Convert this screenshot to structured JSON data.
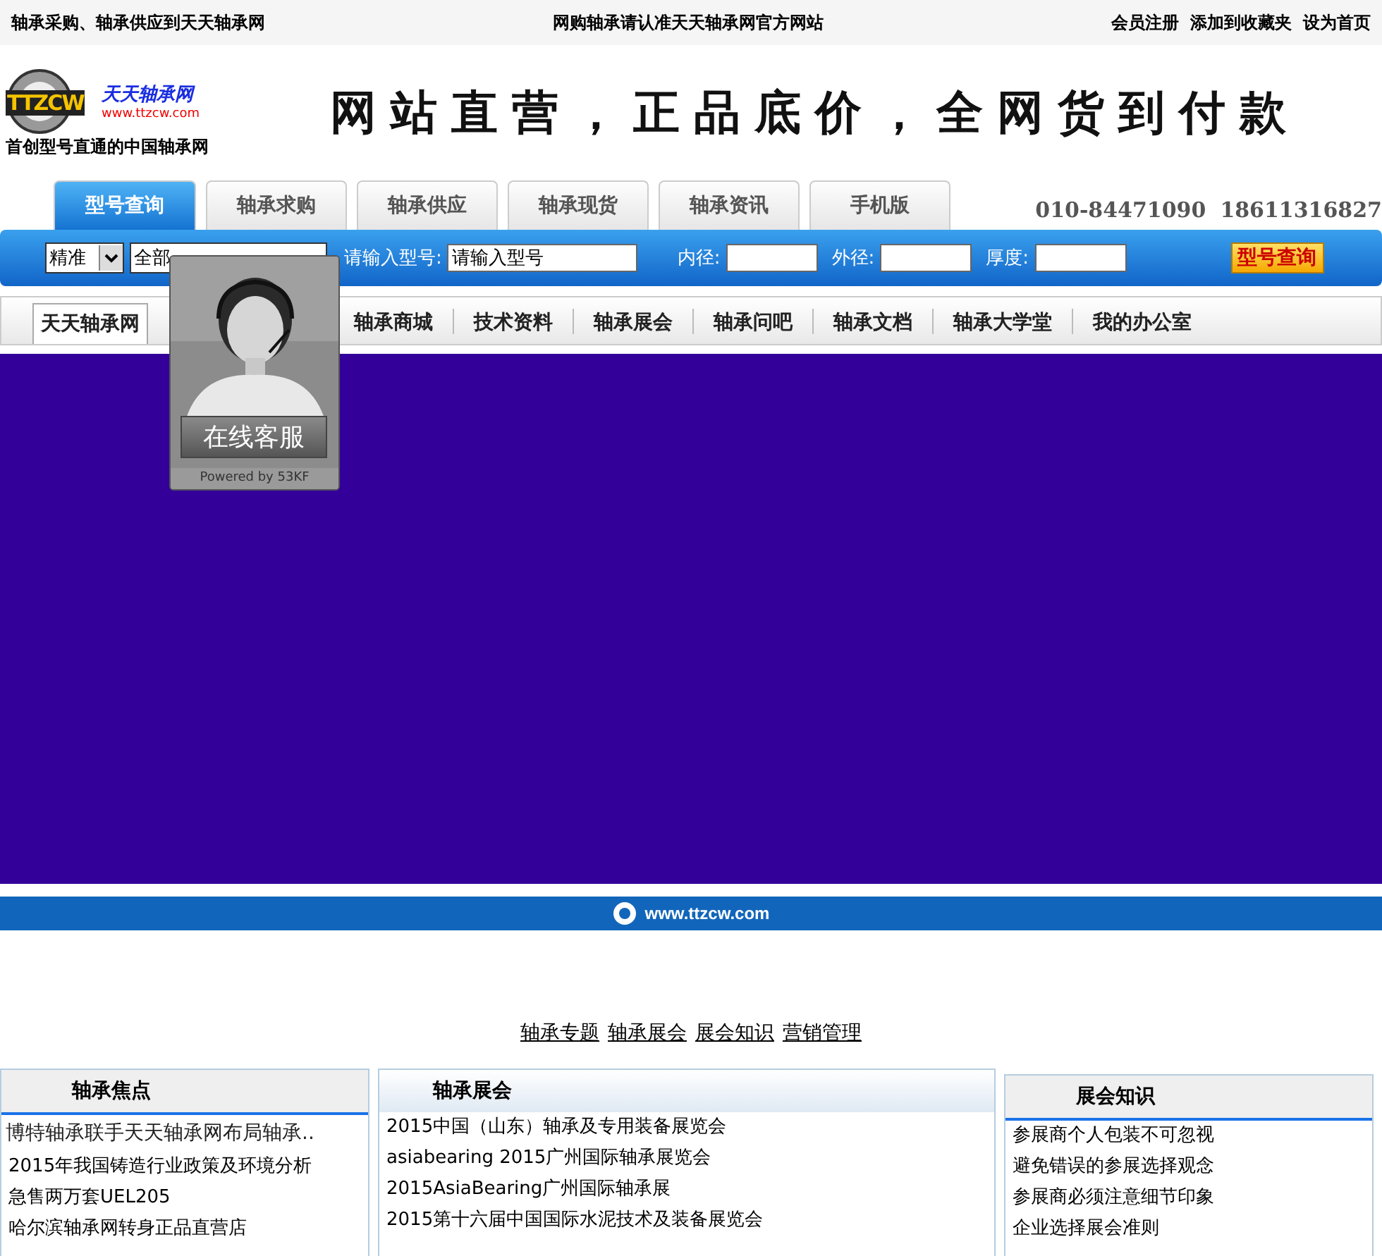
{
  "top_bar": {
    "left": "轴承采购、轴承供应到天天轴承网",
    "center": "网购轴承请认准天天轴承网官方网站",
    "links": [
      "会员注册",
      "添加到收藏夹",
      "设为首页"
    ]
  },
  "header": {
    "logo_text": "TTZCW",
    "logo_name": "天天轴承网",
    "logo_url": "www.ttzcw.com",
    "tagline": "首创型号直通的中国轴承网",
    "slogan": "网站直营，正品底价，全网货到付款"
  },
  "tabs": [
    {
      "label": "型号查询",
      "selected": true
    },
    {
      "label": "轴承求购",
      "selected": false
    },
    {
      "label": "轴承供应",
      "selected": false
    },
    {
      "label": "轴承现货",
      "selected": false
    },
    {
      "label": "轴承资讯",
      "selected": false
    },
    {
      "label": "手机版",
      "selected": false
    }
  ],
  "phones": [
    "010-84471090",
    "18611316827"
  ],
  "search": {
    "mode": "精准",
    "scope": "全部",
    "model_label": "请输入型号:",
    "model_value": "请输入型号",
    "inner_label": "内径:",
    "outer_label": "外径:",
    "thickness_label": "厚度:",
    "button": "型号查询"
  },
  "nav": [
    {
      "label": "天天轴承网",
      "selected": true
    },
    {
      "label": "轴承商城",
      "selected": false
    },
    {
      "label": "技术资料",
      "selected": false
    },
    {
      "label": "轴承展会",
      "selected": false
    },
    {
      "label": "轴承问吧",
      "selected": false
    },
    {
      "label": "轴承文档",
      "selected": false
    },
    {
      "label": "轴承大学堂",
      "selected": false
    },
    {
      "label": "我的办公室",
      "selected": false
    }
  ],
  "chat_widget": {
    "button": "在线客服",
    "powered": "Powered by 53KF"
  },
  "banner_strip": {
    "url": "www.ttzcw.com"
  },
  "links": [
    "轴承专题",
    "轴承展会",
    "展会知识",
    "营销管理"
  ],
  "panels": [
    {
      "title": "轴承焦点",
      "headline": "博特轴承联手天天轴承网布局轴承..",
      "items": [
        "2015年我国铸造行业政策及环境分析",
        "急售两万套UEL205",
        "哈尔滨轴承网转身正品直营店"
      ]
    },
    {
      "title": "轴承展会",
      "items": [
        "2015中国（山东）轴承及专用装备展览会",
        "asiabearing 2015广州国际轴承展览会",
        "2015AsiaBearing广州国际轴承展",
        "2015第十六届中国国际水泥技术及装备展览会"
      ]
    },
    {
      "title": "展会知识",
      "items": [
        "参展商个人包装不可忽视",
        "避免错误的参展选择观念",
        "参展商必须注意细节印象",
        "企业选择展会准则"
      ]
    }
  ]
}
